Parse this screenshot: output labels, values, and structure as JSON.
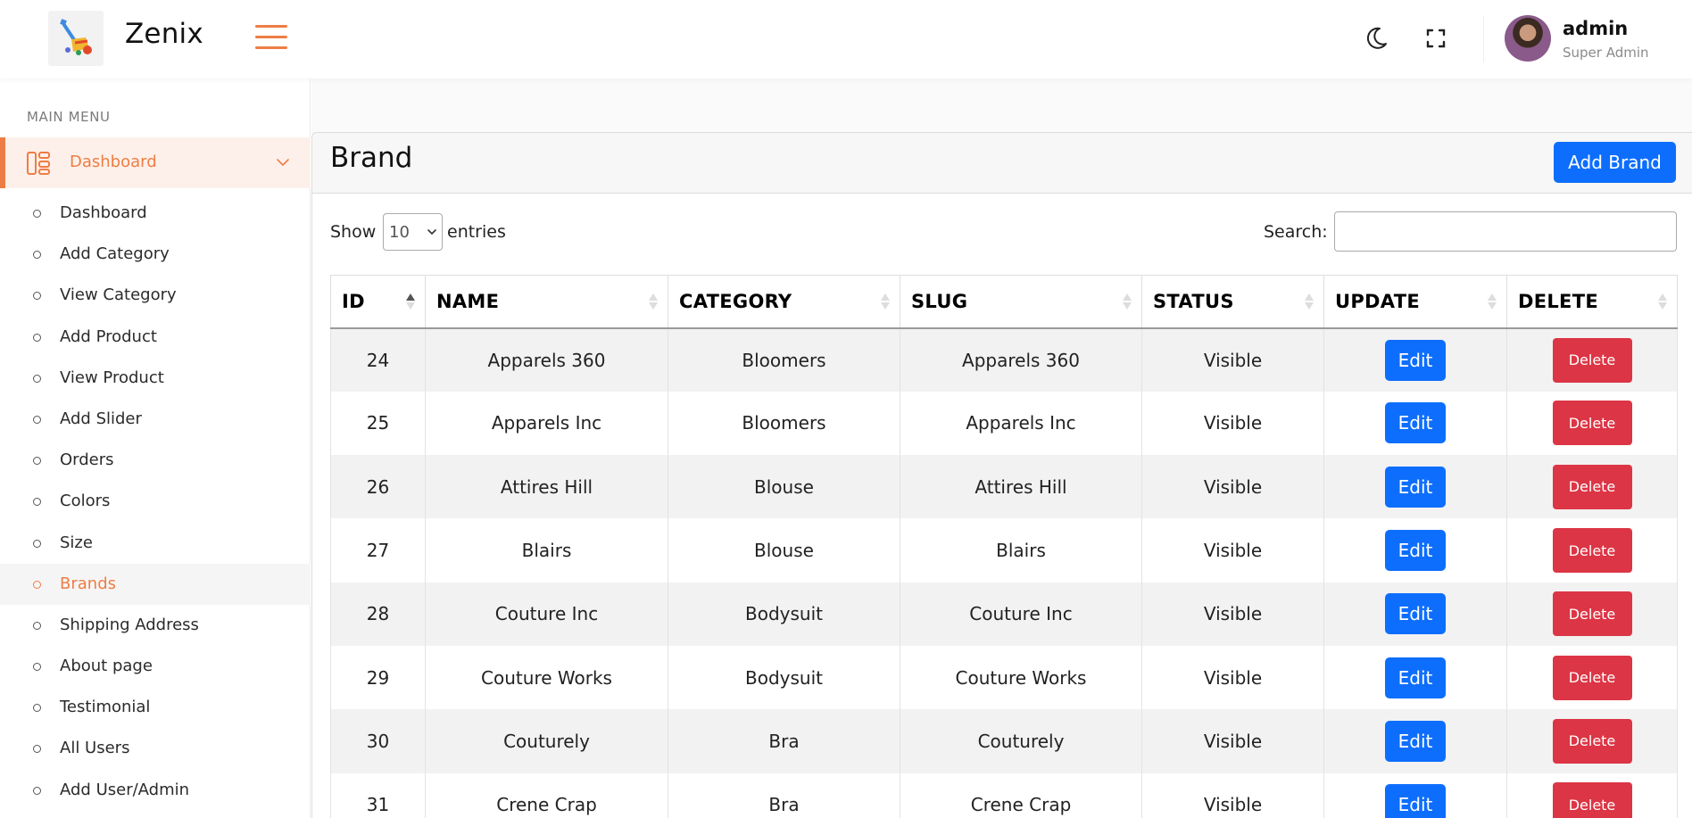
{
  "app": {
    "name": "Zenix"
  },
  "header": {
    "user_name": "admin",
    "user_role": "Super Admin"
  },
  "sidebar": {
    "section_title": "MAIN MENU",
    "main_item": "Dashboard",
    "items": [
      {
        "label": "Dashboard",
        "active": false
      },
      {
        "label": "Add Category",
        "active": false
      },
      {
        "label": "View Category",
        "active": false
      },
      {
        "label": "Add Product",
        "active": false
      },
      {
        "label": "View Product",
        "active": false
      },
      {
        "label": "Add Slider",
        "active": false
      },
      {
        "label": "Orders",
        "active": false
      },
      {
        "label": "Colors",
        "active": false
      },
      {
        "label": "Size",
        "active": false
      },
      {
        "label": "Brands",
        "active": true
      },
      {
        "label": "Shipping Address",
        "active": false
      },
      {
        "label": "About page",
        "active": false
      },
      {
        "label": "Testimonial",
        "active": false
      },
      {
        "label": "All Users",
        "active": false
      },
      {
        "label": "Add User/Admin",
        "active": false
      }
    ]
  },
  "page": {
    "title": "Brand",
    "add_button": "Add Brand",
    "show_label": "Show",
    "entries_value": "10",
    "entries_label": "entries",
    "search_label": "Search:",
    "search_value": ""
  },
  "table": {
    "columns": [
      "ID",
      "NAME",
      "CATEGORY",
      "SLUG",
      "STATUS",
      "UPDATE",
      "DELETE"
    ],
    "edit_label": "Edit",
    "delete_label": "Delete",
    "rows": [
      {
        "id": "24",
        "name": "Apparels 360",
        "category": "Bloomers",
        "slug": "Apparels 360",
        "status": "Visible"
      },
      {
        "id": "25",
        "name": "Apparels Inc",
        "category": "Bloomers",
        "slug": "Apparels Inc",
        "status": "Visible"
      },
      {
        "id": "26",
        "name": "Attires Hill",
        "category": "Blouse",
        "slug": "Attires Hill",
        "status": "Visible"
      },
      {
        "id": "27",
        "name": "Blairs",
        "category": "Blouse",
        "slug": "Blairs",
        "status": "Visible"
      },
      {
        "id": "28",
        "name": "Couture Inc",
        "category": "Bodysuit",
        "slug": "Couture Inc",
        "status": "Visible"
      },
      {
        "id": "29",
        "name": "Couture Works",
        "category": "Bodysuit",
        "slug": "Couture Works",
        "status": "Visible"
      },
      {
        "id": "30",
        "name": "Couturely",
        "category": "Bra",
        "slug": "Couturely",
        "status": "Visible"
      },
      {
        "id": "31",
        "name": "Crene Crap",
        "category": "Bra",
        "slug": "Crene Crap",
        "status": "Visible"
      }
    ]
  },
  "colors": {
    "accent": "#ee7d45",
    "primary": "#0d6efd",
    "danger": "#dc3545"
  },
  "icons": {
    "logo": "logo-icon",
    "menu": "hamburger-icon",
    "theme": "moon-icon",
    "fullscreen": "fullscreen-icon",
    "dashboard": "dashboard-icon",
    "expand": "chevron-down-icon"
  }
}
